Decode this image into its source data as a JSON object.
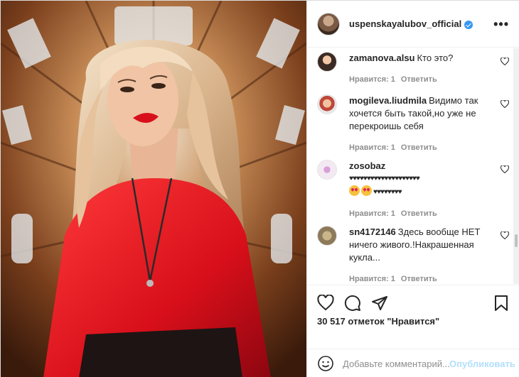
{
  "header": {
    "username": "uspenskayalubov_official",
    "more_icon": "more-horizontal-icon",
    "verified_icon": "verified-badge-icon"
  },
  "comments": [
    {
      "author": "zamanova.alsu",
      "text": "Кто это?",
      "likes": "Нравится: 1",
      "reply": "Ответить"
    },
    {
      "author": "mogileva.liudmila",
      "text": "Видимо так хочется быть такой,но уже не перекроишь себя",
      "likes": "Нравится: 1",
      "reply": "Ответить"
    },
    {
      "author": "zosobaz",
      "text": "♥♥♥♥♥♥♥♥♥♥♥♥♥♥♥♥♥♥♥♥",
      "text2": "♥♥♥♥♥♥♥♥",
      "likes": "Нравится: 1",
      "reply": "Ответить"
    },
    {
      "author": "sn4172146",
      "text": "Здесь вообще НЕТ ничего живого.!Накрашенная кукла...",
      "likes": "Нравится: 1",
      "reply": "Ответить"
    }
  ],
  "actions": {
    "like_icon": "heart-icon",
    "comment_icon": "comment-icon",
    "share_icon": "share-paper-plane-icon",
    "save_icon": "bookmark-icon"
  },
  "likes_text": "30 517 отметок \"Нравится\"",
  "add_comment": {
    "placeholder": "Добавьте комментарий...",
    "publish_label": "Опубликовать",
    "emoji_icon": "emoji-smile-icon"
  },
  "colors": {
    "link_blue": "#3897f0",
    "publish_disabled": "#b2dffc",
    "meta_gray": "#8e8e8e"
  }
}
